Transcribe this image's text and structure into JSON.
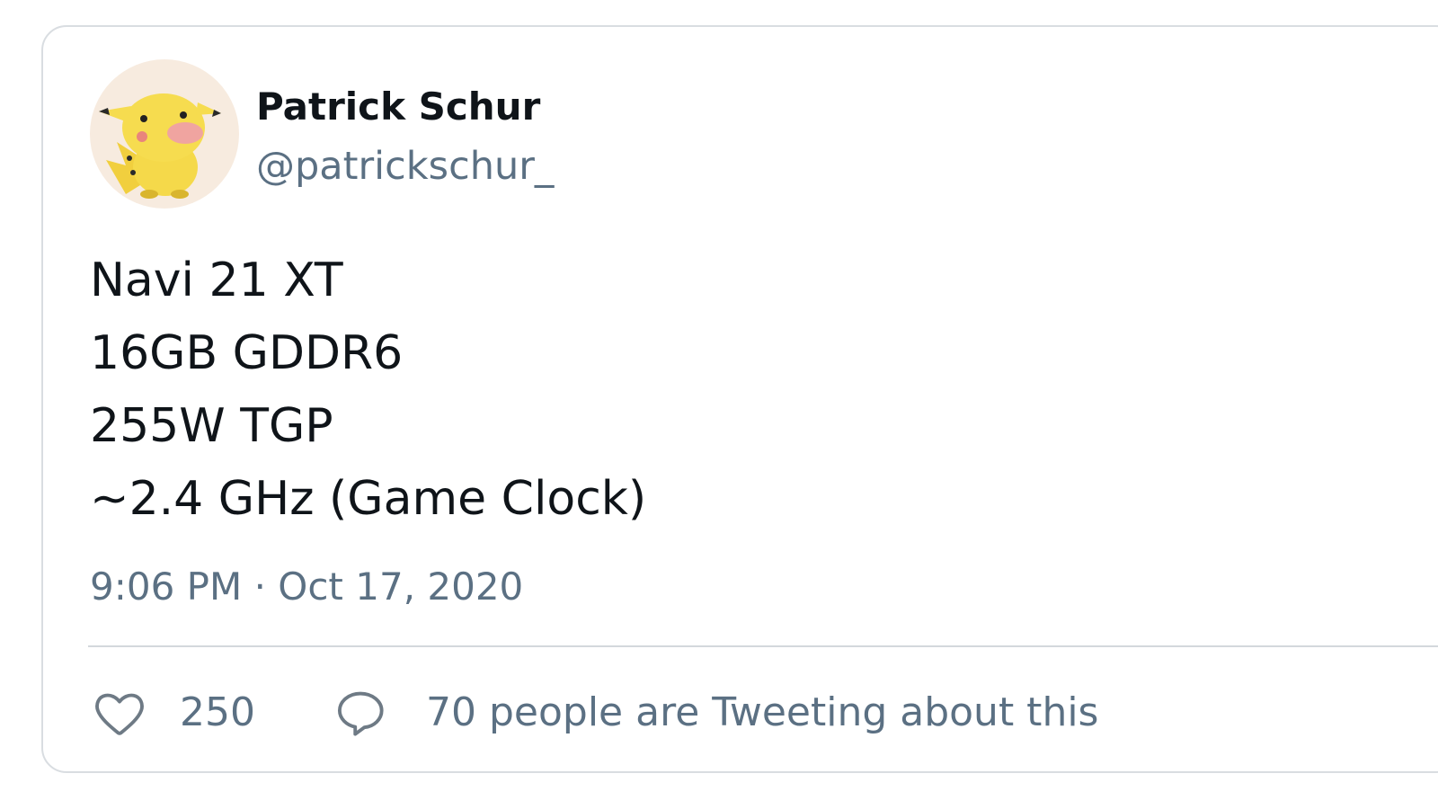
{
  "author": {
    "display_name": "Patrick Schur",
    "handle": "@patrickschur_"
  },
  "tweet": {
    "lines": [
      "Navi 21 XT",
      "16GB GDDR6",
      "255W TGP",
      "~2.4 GHz (Game Clock)"
    ],
    "timestamp": "9:06 PM · Oct 17, 2020"
  },
  "actions": {
    "like_count": "250",
    "conversation_text": "70 people are Tweeting about this"
  },
  "icons": {
    "like": "heart-icon",
    "reply": "speech-bubble-icon",
    "avatar": "pikachu-avatar"
  },
  "colors": {
    "primary_text": "#0f1419",
    "secondary_text": "#5b7083",
    "border": "#d9dde1",
    "avatar_background": "#f7ebdf",
    "avatar_character": "#f5d94a"
  }
}
